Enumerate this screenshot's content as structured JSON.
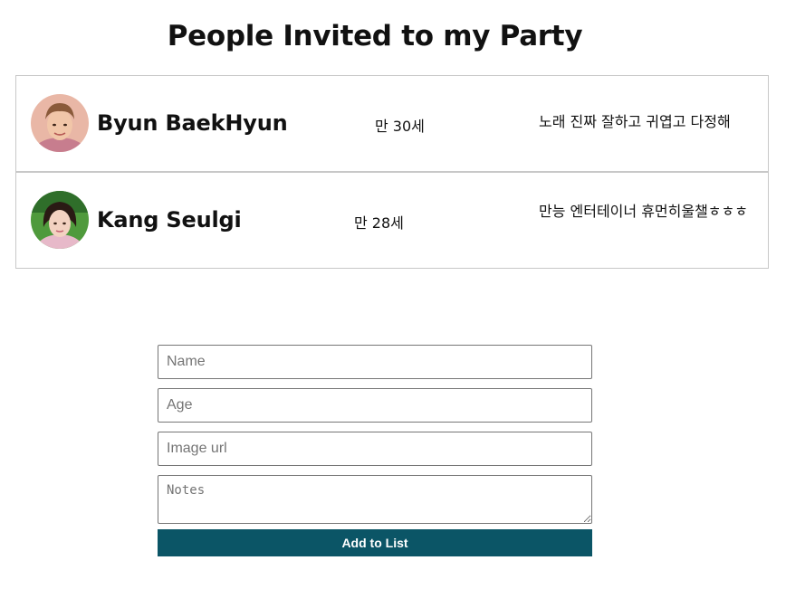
{
  "page": {
    "title": "People Invited to my Party"
  },
  "people": [
    {
      "name": "Byun BaekHyun",
      "age": "만 30세",
      "notes": "노래 진짜 잘하고 귀엽고 다정해"
    },
    {
      "name": "Kang Seulgi",
      "age": "만 28세",
      "notes": "만능 엔터테이너 휴먼히울챌ㅎㅎㅎ"
    }
  ],
  "form": {
    "name_placeholder": "Name",
    "age_placeholder": "Age",
    "image_url_placeholder": "Image url",
    "notes_placeholder": "Notes",
    "submit_label": "Add to List"
  },
  "colors": {
    "button_bg": "#0b5566",
    "row_border": "#c8c8c8"
  }
}
